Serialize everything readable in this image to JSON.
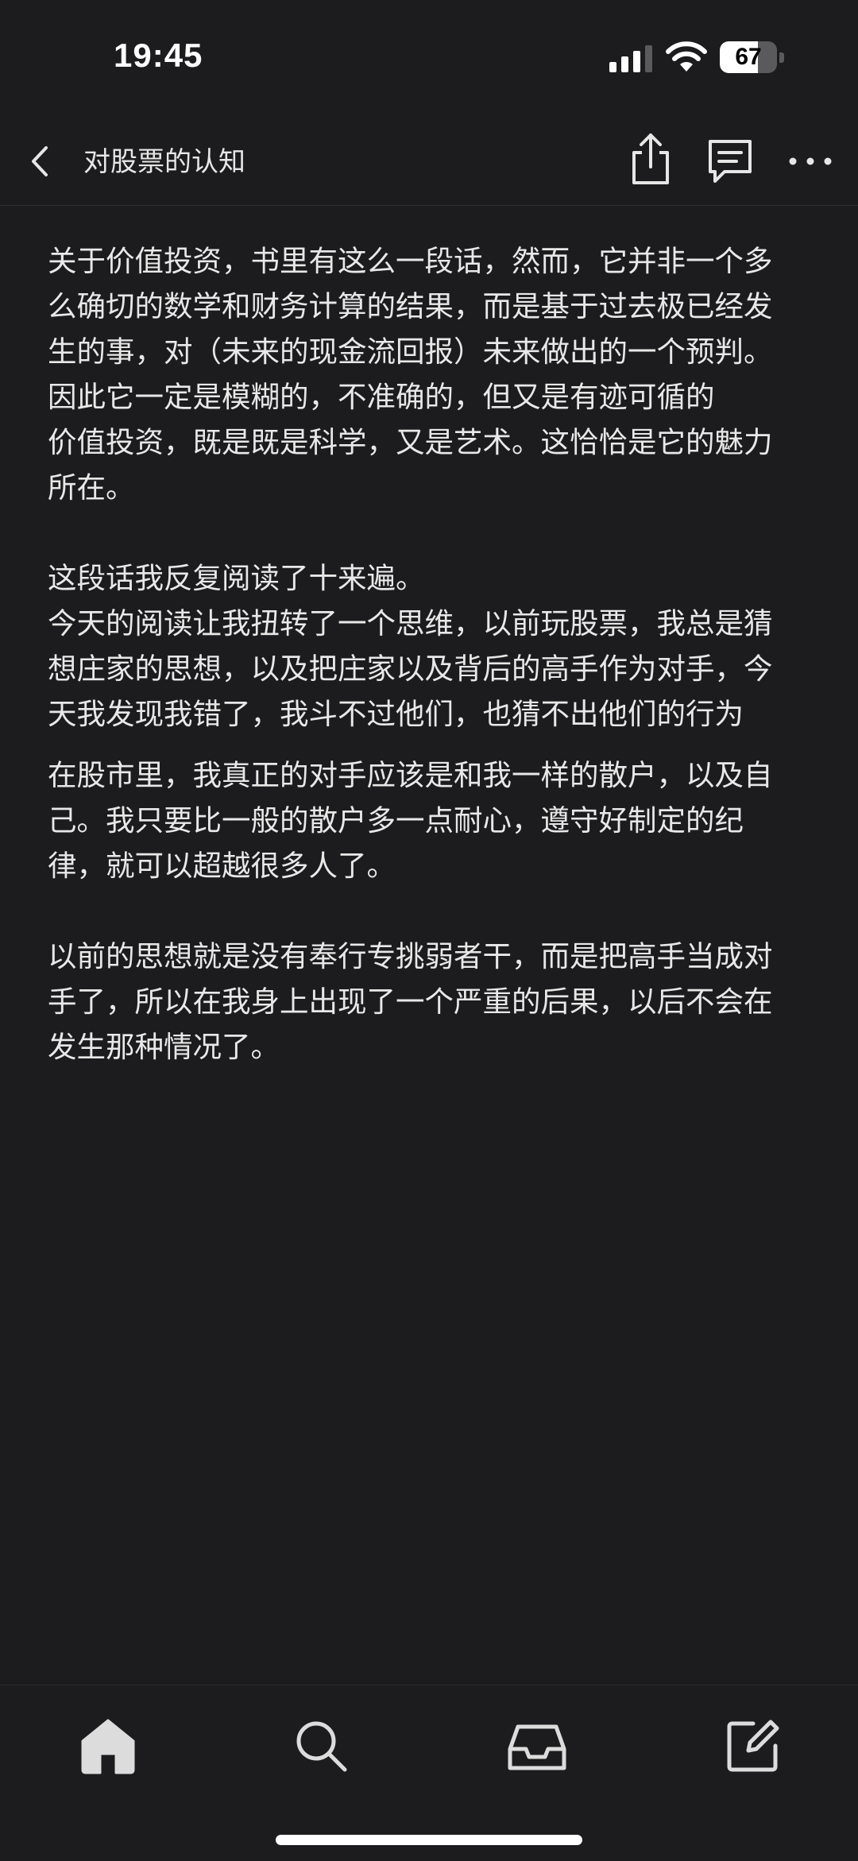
{
  "status_bar": {
    "time": "19:45",
    "battery_level": "67",
    "battery_fraction": 0.67
  },
  "nav": {
    "title": "对股票的认知",
    "icons": [
      "back-icon",
      "share-icon",
      "comment-icon",
      "more-icon"
    ]
  },
  "article": {
    "paragraphs": [
      "关于价值投资，书里有这么一段话，然而，它并非一个多么确切的数学和财务计算的结果，而是基于过去极已经发生的事，对（未来的现金流回报）未来做出的一个预判。因此它一定是模糊的，不准确的，但又是有迹可循的",
      "价值投资，既是既是科学，又是艺术。这恰恰是它的魅力所在。",
      "这段话我反复阅读了十来遍。",
      "今天的阅读让我扭转了一个思维，以前玩股票，我总是猜想庄家的思想，以及把庄家以及背后的高手作为对手，今天我发现我错了，我斗不过他们，也猜不出他们的行为",
      "在股市里，我真正的对手应该是和我一样的散户，以及自己。我只要比一般的散户多一点耐心，遵守好制定的纪律，就可以超越很多人了。",
      "以前的思想就是没有奉行专挑弱者干，而是把高手当成对手了，所以在我身上出现了一个严重的后果，以后不会在发生那种情况了。"
    ]
  },
  "tab_bar": {
    "icons": [
      "home-icon",
      "search-icon",
      "inbox-icon",
      "compose-icon"
    ]
  },
  "colors": {
    "background": "#1c1c1e",
    "text": "#e8e8e8"
  }
}
